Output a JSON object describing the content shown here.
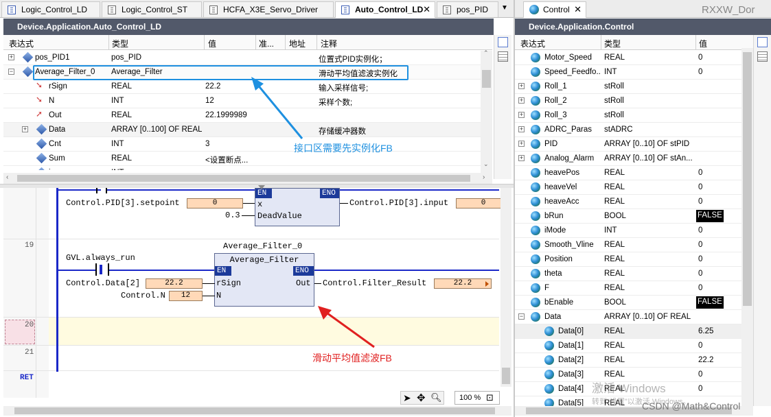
{
  "tabs": [
    {
      "label": "Logic_Control_LD",
      "icon": "ld-file-icon",
      "active": false
    },
    {
      "label": "Logic_Control_ST",
      "icon": "st-file-icon",
      "active": false
    },
    {
      "label": "HCFA_X3E_Servo_Driver",
      "icon": "device-icon",
      "active": false
    },
    {
      "label": "Auto_Control_LD",
      "icon": "ld-file-icon",
      "active": true,
      "close": "✕"
    },
    {
      "label": "pos_PID",
      "icon": "st-file-icon",
      "active": false
    }
  ],
  "tab_dropdown": "▼",
  "right_tab": {
    "label": "Control",
    "close": "✕"
  },
  "top_right_text": "RXXW_Dor",
  "left_panel": {
    "title": "Device.Application.Auto_Control_LD",
    "columns": [
      "表达式",
      "类型",
      "值",
      "准...",
      "地址",
      "注释"
    ],
    "rows": [
      {
        "expand": "+",
        "indent": 0,
        "icon": "diamond",
        "expr": "pos_PID1",
        "type": "pos_PID",
        "value": "",
        "comment": "位置式PID实例化；"
      },
      {
        "expand": "−",
        "indent": 0,
        "icon": "diamond",
        "expr": "Average_Filter_0",
        "type": "Average_Filter",
        "value": "",
        "comment": "滑动平均值滤波实例化"
      },
      {
        "expand": "",
        "indent": 1,
        "icon": "input",
        "expr": "rSign",
        "type": "REAL",
        "value": "22.2",
        "comment": "输入采样信号;"
      },
      {
        "expand": "",
        "indent": 1,
        "icon": "input",
        "expr": "N",
        "type": "INT",
        "value": "12",
        "comment": "采样个数;"
      },
      {
        "expand": "",
        "indent": 1,
        "icon": "output",
        "expr": "Out",
        "type": "REAL",
        "value": "22.1999989",
        "comment": ""
      },
      {
        "expand": "+",
        "indent": 1,
        "icon": "diamond",
        "expr": "Data",
        "type": "ARRAY [0..100] OF REAL",
        "value": "",
        "comment": "存储缓冲器数"
      },
      {
        "expand": "",
        "indent": 1,
        "icon": "diamond",
        "expr": "Cnt",
        "type": "INT",
        "value": "3",
        "comment": ""
      },
      {
        "expand": "",
        "indent": 1,
        "icon": "diamond",
        "expr": "Sum",
        "type": "REAL",
        "value": "<设置断点...",
        "comment": ""
      },
      {
        "expand": "",
        "indent": 1,
        "icon": "diamond",
        "expr": "i",
        "type": "INT",
        "value": "<设置断点...",
        "comment": ""
      }
    ],
    "annotation": "接口区需要先实例化FB"
  },
  "ladder": {
    "rung18": {
      "setpoint_label": "Control.PID[3].setpoint",
      "setpoint_value": "0",
      "deadvalue": "0.3",
      "pin_x": "x",
      "pin_deadvalue": "DeadValue",
      "en": "EN",
      "eno": "ENO",
      "output_label": "Control.PID[3].input",
      "output_value": "0"
    },
    "rung19": {
      "number": "19",
      "contact_label": "GVL.always_run",
      "instance": "Average_Filter_0",
      "fb_type": "Average_Filter",
      "en": "EN",
      "eno": "ENO",
      "pin_rsign": "rSign",
      "pin_n": "N",
      "pin_out": "Out",
      "in1_label": "Control.Data[2]",
      "in1_value": "22.2",
      "in2_label": "Control.N",
      "in2_value": "12",
      "out_label": "Control.Filter_Result",
      "out_value": "22.2"
    },
    "rung20": "20",
    "rung21": "21",
    "ret": "RET",
    "annotation": "滑动平均值滤波FB",
    "zoom": "100 %"
  },
  "right_panel": {
    "title": "Device.Application.Control",
    "columns": [
      "表达式",
      "类型",
      "值"
    ],
    "rows": [
      {
        "expand": "",
        "indent": 0,
        "expr": "Motor_Speed",
        "type": "REAL",
        "value": "0"
      },
      {
        "expand": "",
        "indent": 0,
        "expr": "Speed_Feedfo...",
        "type": "INT",
        "value": "0"
      },
      {
        "expand": "+",
        "indent": 0,
        "expr": "Roll_1",
        "type": "stRoll",
        "value": ""
      },
      {
        "expand": "+",
        "indent": 0,
        "expr": "Roll_2",
        "type": "stRoll",
        "value": ""
      },
      {
        "expand": "+",
        "indent": 0,
        "expr": "Roll_3",
        "type": "stRoll",
        "value": ""
      },
      {
        "expand": "+",
        "indent": 0,
        "expr": "ADRC_Paras",
        "type": "stADRC",
        "value": ""
      },
      {
        "expand": "+",
        "indent": 0,
        "expr": "PID",
        "type": "ARRAY [0..10] OF stPID",
        "value": ""
      },
      {
        "expand": "+",
        "indent": 0,
        "expr": "Analog_Alarm",
        "type": "ARRAY [0..10] OF stAn...",
        "value": ""
      },
      {
        "expand": "",
        "indent": 0,
        "expr": "heavePos",
        "type": "REAL",
        "value": "0"
      },
      {
        "expand": "",
        "indent": 0,
        "expr": "heaveVel",
        "type": "REAL",
        "value": "0"
      },
      {
        "expand": "",
        "indent": 0,
        "expr": "heaveAcc",
        "type": "REAL",
        "value": "0"
      },
      {
        "expand": "",
        "indent": 0,
        "expr": "bRun",
        "type": "BOOL",
        "value": "FALSE",
        "bool": true
      },
      {
        "expand": "",
        "indent": 0,
        "expr": "iMode",
        "type": "INT",
        "value": "0"
      },
      {
        "expand": "",
        "indent": 0,
        "expr": "Smooth_Vline",
        "type": "REAL",
        "value": "0"
      },
      {
        "expand": "",
        "indent": 0,
        "expr": "Position",
        "type": "REAL",
        "value": "0"
      },
      {
        "expand": "",
        "indent": 0,
        "expr": "theta",
        "type": "REAL",
        "value": "0"
      },
      {
        "expand": "",
        "indent": 0,
        "expr": "F",
        "type": "REAL",
        "value": "0"
      },
      {
        "expand": "",
        "indent": 0,
        "expr": "bEnable",
        "type": "BOOL",
        "value": "FALSE",
        "bool": true
      },
      {
        "expand": "−",
        "indent": 0,
        "expr": "Data",
        "type": "ARRAY [0..10] OF REAL",
        "value": ""
      },
      {
        "expand": "",
        "indent": 1,
        "expr": "Data[0]",
        "type": "REAL",
        "value": "6.25"
      },
      {
        "expand": "",
        "indent": 1,
        "expr": "Data[1]",
        "type": "REAL",
        "value": "0"
      },
      {
        "expand": "",
        "indent": 1,
        "expr": "Data[2]",
        "type": "REAL",
        "value": "22.2"
      },
      {
        "expand": "",
        "indent": 1,
        "expr": "Data[3]",
        "type": "REAL",
        "value": "0"
      },
      {
        "expand": "",
        "indent": 1,
        "expr": "Data[4]",
        "type": "REAL",
        "value": "0"
      },
      {
        "expand": "",
        "indent": 1,
        "expr": "Data[5]",
        "type": "REAL",
        "value": ""
      }
    ]
  },
  "watermark": {
    "line1": "激活 Windows",
    "line2": "转到\"设置\"以激活 Windows。",
    "credit": "CSDN @Math&Control"
  },
  "colors": {
    "accent_blue": "#1a28c8",
    "annotation_blue": "#1e90e0",
    "annotation_red": "#e02020",
    "header": "#52596a"
  }
}
